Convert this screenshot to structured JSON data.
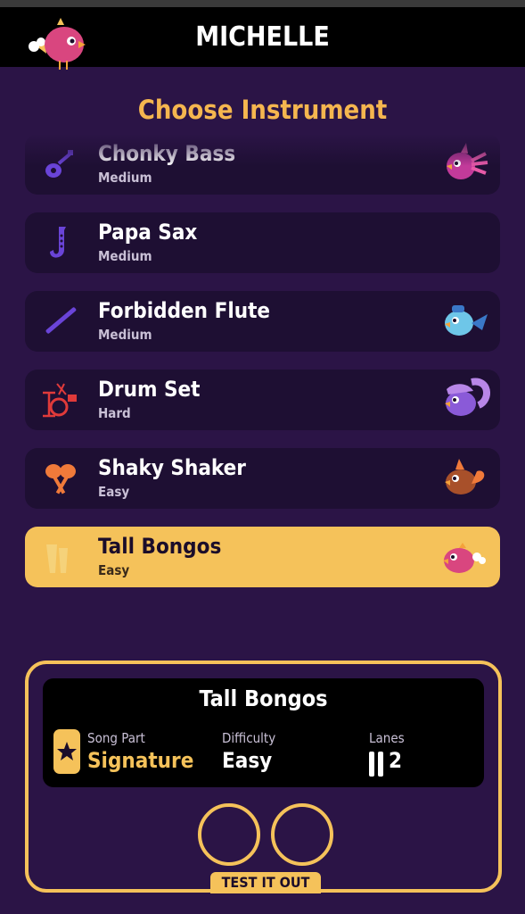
{
  "header": {
    "player_name": "MICHELLE"
  },
  "title": "Choose Instrument",
  "instruments": [
    {
      "name": "Chonky Bass",
      "difficulty": "Medium",
      "icon": "guitar-icon",
      "bird": "pink-crested-bird",
      "color": "#6a44d8",
      "selected": false
    },
    {
      "name": "Papa Sax",
      "difficulty": "Medium",
      "icon": "saxophone-icon",
      "bird": "",
      "color": "#6a44d8",
      "selected": false
    },
    {
      "name": "Forbidden Flute",
      "difficulty": "Medium",
      "icon": "flute-icon",
      "bird": "blue-bird",
      "color": "#6a44d8",
      "selected": false
    },
    {
      "name": "Drum Set",
      "difficulty": "Hard",
      "icon": "drum-set-icon",
      "bird": "purple-bird",
      "color": "#e03a3a",
      "selected": false
    },
    {
      "name": "Shaky Shaker",
      "difficulty": "Easy",
      "icon": "maracas-icon",
      "bird": "brown-bird",
      "color": "#f07a3a",
      "selected": false
    },
    {
      "name": "Tall Bongos",
      "difficulty": "Easy",
      "icon": "bongos-icon",
      "bird": "pink-bird",
      "color": "#f5d27a",
      "selected": true
    }
  ],
  "detail": {
    "instrument_name": "Tall Bongos",
    "song_part_label": "Song Part",
    "song_part_value": "Signature",
    "difficulty_label": "Difficulty",
    "difficulty_value": "Easy",
    "lanes_label": "Lanes",
    "lanes_value": "2",
    "test_button_label": "TEST IT OUT"
  },
  "colors": {
    "background": "#2b1446",
    "card": "#1e0f33",
    "accent": "#f5c25a",
    "title": "#f5b64f"
  }
}
